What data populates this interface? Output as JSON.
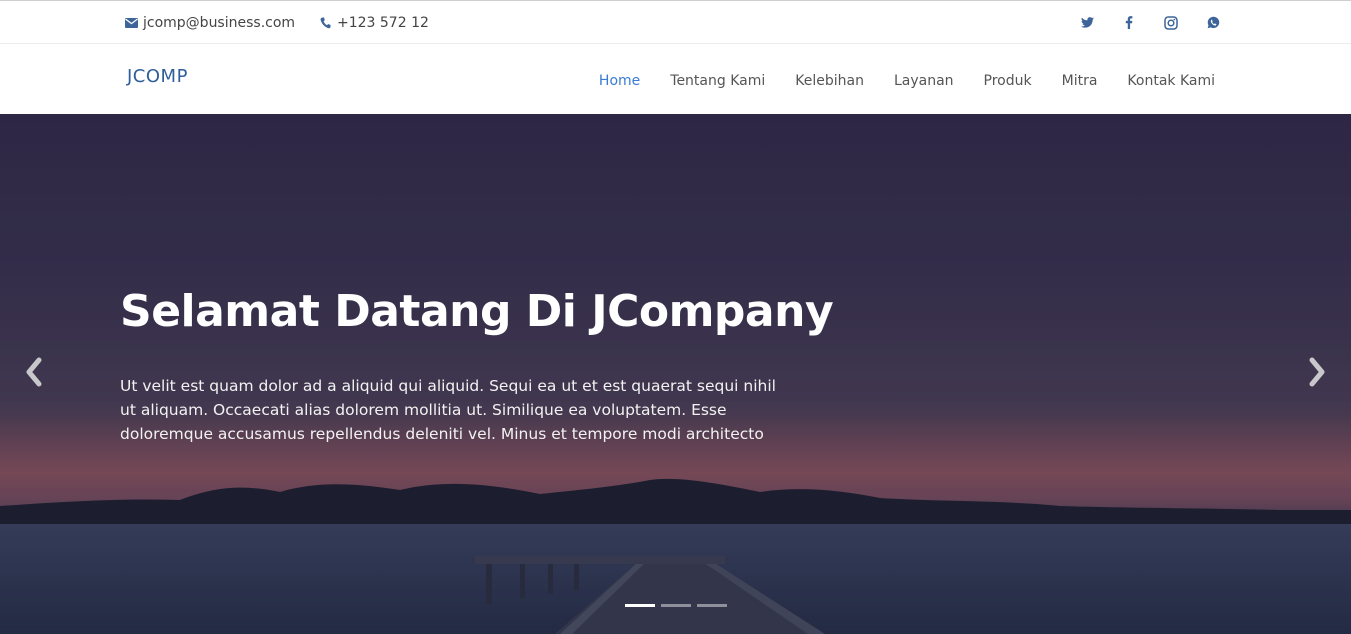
{
  "topbar": {
    "email": "jcomp@business.com",
    "phone": "+123 572 12",
    "email_icon": "envelope-icon",
    "phone_icon": "phone-icon",
    "social": [
      {
        "name": "twitter-icon"
      },
      {
        "name": "facebook-icon"
      },
      {
        "name": "instagram-icon"
      },
      {
        "name": "whatsapp-icon"
      }
    ]
  },
  "header": {
    "logo": "JCOMP",
    "nav": [
      {
        "label": "Home",
        "active": true
      },
      {
        "label": "Tentang Kami",
        "active": false
      },
      {
        "label": "Kelebihan",
        "active": false
      },
      {
        "label": "Layanan",
        "active": false
      },
      {
        "label": "Produk",
        "active": false
      },
      {
        "label": "Mitra",
        "active": false
      },
      {
        "label": "Kontak Kami",
        "active": false
      }
    ]
  },
  "hero": {
    "title": "Selamat Datang Di JCompany",
    "text": "Ut velit est quam dolor ad a aliquid qui aliquid. Sequi ea ut et est quaerat sequi nihil ut aliquam. Occaecati alias dolorem mollitia ut. Similique ea voluptatem. Esse doloremque accusamus repellendus deleniti vel. Minus et tempore modi architecto",
    "slides_count": 3,
    "active_slide": 1,
    "prev_icon": "chevron-left-icon",
    "next_icon": "chevron-right-icon"
  },
  "colors": {
    "accent": "#3b7bd4",
    "logo": "#2f5f9a",
    "icon": "#3d6599"
  }
}
